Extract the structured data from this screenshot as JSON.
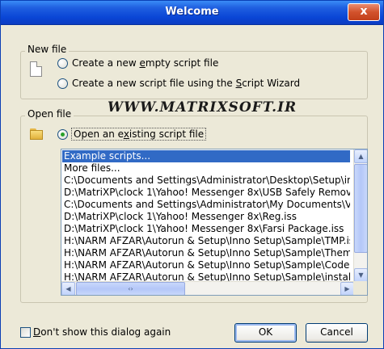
{
  "window": {
    "title": "Welcome",
    "close_label": "x"
  },
  "new_file": {
    "group_label": "New file",
    "option_empty": {
      "prefix": "Create a new ",
      "underlined": "e",
      "suffix": "mpty script file"
    },
    "option_wizard": {
      "prefix": "Create a new script file using the ",
      "underlined": "S",
      "suffix": "cript Wizard"
    }
  },
  "open_file": {
    "group_label": "Open file",
    "option_existing": {
      "prefix": "Open an e",
      "underlined": "x",
      "suffix": "isting script file",
      "selected": true
    }
  },
  "watermark": "WWW.MATRIXSOFT.IR",
  "file_list": {
    "selected_index": 0,
    "items": [
      "Example scripts...",
      "More files...",
      "C:\\Documents and Settings\\Administrator\\Desktop\\Setup\\inst",
      "D:\\MatriXP\\clock 1\\Yahoo! Messenger 8x\\USB Safely Remove'",
      "C:\\Documents and Settings\\Administrator\\My Documents\\Visu",
      "D:\\MatriXP\\clock 1\\Yahoo! Messenger 8x\\Reg.iss",
      "D:\\MatriXP\\clock 1\\Yahoo! Messenger 8x\\Farsi Package.iss",
      "H:\\NARM AFZAR\\Autorun & Setup\\Inno Setup\\Sample\\TMP.is",
      "H:\\NARM AFZAR\\Autorun & Setup\\Inno Setup\\Sample\\Them.i",
      "H:\\NARM AFZAR\\Autorun & Setup\\Inno Setup\\Sample\\CodeD",
      "H:\\NARM AFZAR\\Autorun & Setup\\Inno Setup\\Sample\\install"
    ]
  },
  "scrollbar": {
    "up": "▲",
    "down": "▼",
    "left": "◀",
    "right": "▶",
    "grip": "‹›"
  },
  "footer": {
    "dont_show": {
      "prefix": "",
      "underlined": "D",
      "suffix": "on't show this dialog again",
      "checked": false
    },
    "ok_label": "OK",
    "cancel_label": "Cancel"
  }
}
